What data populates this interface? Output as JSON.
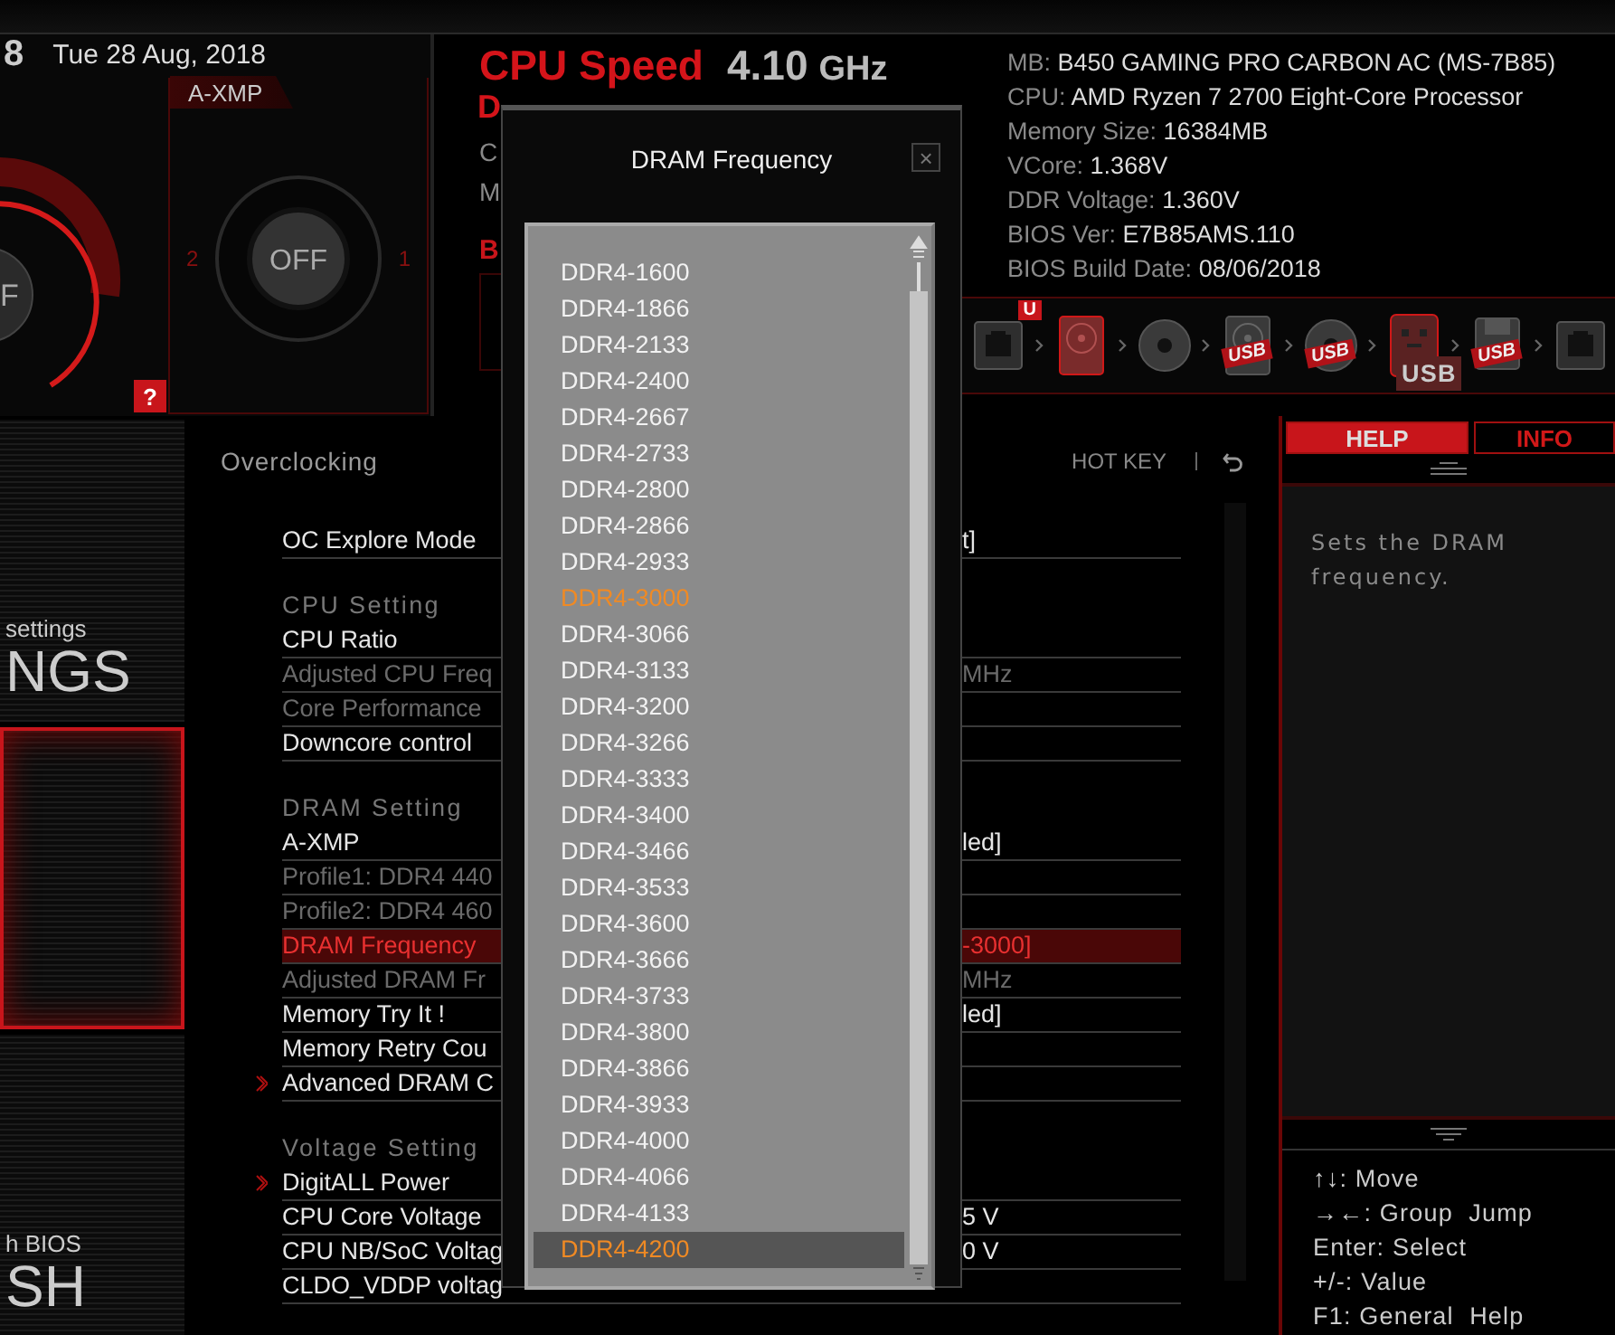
{
  "header": {
    "clock": "8",
    "date": "Tue  28 Aug, 2018",
    "boost_knob": {
      "label": "F"
    },
    "axmp": {
      "title": "A-XMP",
      "knob": "OFF",
      "left_label": "2",
      "right_label": "1"
    },
    "help_button": "?"
  },
  "speed": {
    "cpu_label": "CPU Speed",
    "cpu_value": "4.10",
    "cpu_unit": "GHz",
    "fragments": [
      {
        "text": "D",
        "kind": "title"
      },
      {
        "text": "C",
        "kind": "info"
      },
      {
        "text": "M",
        "kind": "info"
      },
      {
        "text": "B",
        "kind": "heading"
      }
    ]
  },
  "system_info": [
    {
      "label": "MB:",
      "value": "B450 GAMING PRO CARBON AC (MS-7B85)"
    },
    {
      "label": "CPU:",
      "value": "AMD Ryzen 7 2700 Eight-Core Processor"
    },
    {
      "label": "Memory Size:",
      "value": "16384MB"
    },
    {
      "label": "VCore:",
      "value": "1.368V"
    },
    {
      "label": "DDR Voltage:",
      "value": "1.360V"
    },
    {
      "label": "BIOS Ver:",
      "value": "E7B85AMS.110"
    },
    {
      "label": "BIOS Build Date:",
      "value": "08/06/2018"
    }
  ],
  "boot_devices": [
    {
      "kind": "network",
      "badge": "U",
      "selected": false
    },
    {
      "kind": "hdd",
      "selected": true
    },
    {
      "kind": "disc",
      "selected": false
    },
    {
      "kind": "hdd",
      "usb": "USB",
      "selected": false
    },
    {
      "kind": "disc",
      "usb": "USB",
      "selected": false
    },
    {
      "kind": "key",
      "usb": "USB",
      "selected": false
    },
    {
      "kind": "floppy",
      "usb": "USB",
      "selected": false
    },
    {
      "kind": "network",
      "selected": false
    }
  ],
  "sidebar": [
    {
      "caption": "settings",
      "title": "NGS",
      "selected": false
    },
    {
      "selected": true
    },
    {
      "caption": "h BIOS",
      "title": "SH",
      "selected": false
    }
  ],
  "main": {
    "section": "Overclocking",
    "hotkey": "HOT KEY",
    "rows": [
      {
        "kind": "setting",
        "label": "OC Explore Mode",
        "value": "t]",
        "disabled": false,
        "selected": false
      },
      {
        "kind": "header",
        "label": "CPU  Setting"
      },
      {
        "kind": "setting",
        "label": "CPU Ratio",
        "disabled": false,
        "selected": false
      },
      {
        "kind": "setting",
        "label": "Adjusted CPU Freq",
        "value": "MHz",
        "disabled": true,
        "selected": false
      },
      {
        "kind": "setting",
        "label": "Core Performance",
        "disabled": true,
        "selected": false
      },
      {
        "kind": "setting",
        "label": "Downcore control",
        "disabled": false,
        "selected": false
      },
      {
        "kind": "header",
        "label": "DRAM  Setting"
      },
      {
        "kind": "setting",
        "label": "A-XMP",
        "value": "led]",
        "disabled": false,
        "selected": false
      },
      {
        "kind": "setting",
        "label": "Profile1: DDR4 440",
        "disabled": true,
        "selected": false
      },
      {
        "kind": "setting",
        "label": "Profile2: DDR4 460",
        "disabled": true,
        "selected": false
      },
      {
        "kind": "setting",
        "label": "DRAM Frequency",
        "value": "-3000]",
        "disabled": false,
        "selected": true
      },
      {
        "kind": "setting",
        "label": "Adjusted DRAM Fr",
        "value": "MHz",
        "disabled": true,
        "selected": false
      },
      {
        "kind": "setting",
        "label": "Memory Try It !",
        "value": "led]",
        "disabled": false,
        "selected": false
      },
      {
        "kind": "setting",
        "label": "Memory Retry Cou",
        "disabled": false,
        "selected": false
      },
      {
        "kind": "submenu",
        "label": "Advanced DRAM C",
        "disabled": false,
        "selected": false
      },
      {
        "kind": "header",
        "label": "Voltage  Setting"
      },
      {
        "kind": "submenu",
        "label": "DigitALL Power",
        "disabled": false,
        "selected": false
      },
      {
        "kind": "setting",
        "label": "CPU Core Voltage",
        "value": "5 V",
        "disabled": false,
        "selected": false
      },
      {
        "kind": "setting",
        "label": "CPU NB/SoC Voltag",
        "value": "0 V",
        "disabled": false,
        "selected": false
      },
      {
        "kind": "setting",
        "label": "CLDO_VDDP voltag",
        "disabled": false,
        "selected": false
      }
    ]
  },
  "help": {
    "tabs": [
      {
        "label": "HELP",
        "selected": true
      },
      {
        "label": "INFO",
        "selected": false
      }
    ],
    "text": "Sets the DRAM frequency.",
    "keys": [
      "↑↓: Move",
      "→←: Group  Jump",
      "Enter: Select",
      "+/-: Value",
      "F1: General  Help"
    ]
  },
  "dialog": {
    "title": "DRAM Frequency",
    "close": "×",
    "options": [
      {
        "label": "DDR4-1600",
        "selected": false,
        "current": false
      },
      {
        "label": "DDR4-1866",
        "selected": false,
        "current": false
      },
      {
        "label": "DDR4-2133",
        "selected": false,
        "current": false
      },
      {
        "label": "DDR4-2400",
        "selected": false,
        "current": false
      },
      {
        "label": "DDR4-2667",
        "selected": false,
        "current": false
      },
      {
        "label": "DDR4-2733",
        "selected": false,
        "current": false
      },
      {
        "label": "DDR4-2800",
        "selected": false,
        "current": false
      },
      {
        "label": "DDR4-2866",
        "selected": false,
        "current": false
      },
      {
        "label": "DDR4-2933",
        "selected": false,
        "current": false
      },
      {
        "label": "DDR4-3000",
        "selected": false,
        "current": true
      },
      {
        "label": "DDR4-3066",
        "selected": false,
        "current": false
      },
      {
        "label": "DDR4-3133",
        "selected": false,
        "current": false
      },
      {
        "label": "DDR4-3200",
        "selected": false,
        "current": false
      },
      {
        "label": "DDR4-3266",
        "selected": false,
        "current": false
      },
      {
        "label": "DDR4-3333",
        "selected": false,
        "current": false
      },
      {
        "label": "DDR4-3400",
        "selected": false,
        "current": false
      },
      {
        "label": "DDR4-3466",
        "selected": false,
        "current": false
      },
      {
        "label": "DDR4-3533",
        "selected": false,
        "current": false
      },
      {
        "label": "DDR4-3600",
        "selected": false,
        "current": false
      },
      {
        "label": "DDR4-3666",
        "selected": false,
        "current": false
      },
      {
        "label": "DDR4-3733",
        "selected": false,
        "current": false
      },
      {
        "label": "DDR4-3800",
        "selected": false,
        "current": false
      },
      {
        "label": "DDR4-3866",
        "selected": false,
        "current": false
      },
      {
        "label": "DDR4-3933",
        "selected": false,
        "current": false
      },
      {
        "label": "DDR4-4000",
        "selected": false,
        "current": false
      },
      {
        "label": "DDR4-4066",
        "selected": false,
        "current": false
      },
      {
        "label": "DDR4-4133",
        "selected": false,
        "current": false
      },
      {
        "label": "DDR4-4200",
        "selected": true,
        "current": false
      }
    ]
  }
}
